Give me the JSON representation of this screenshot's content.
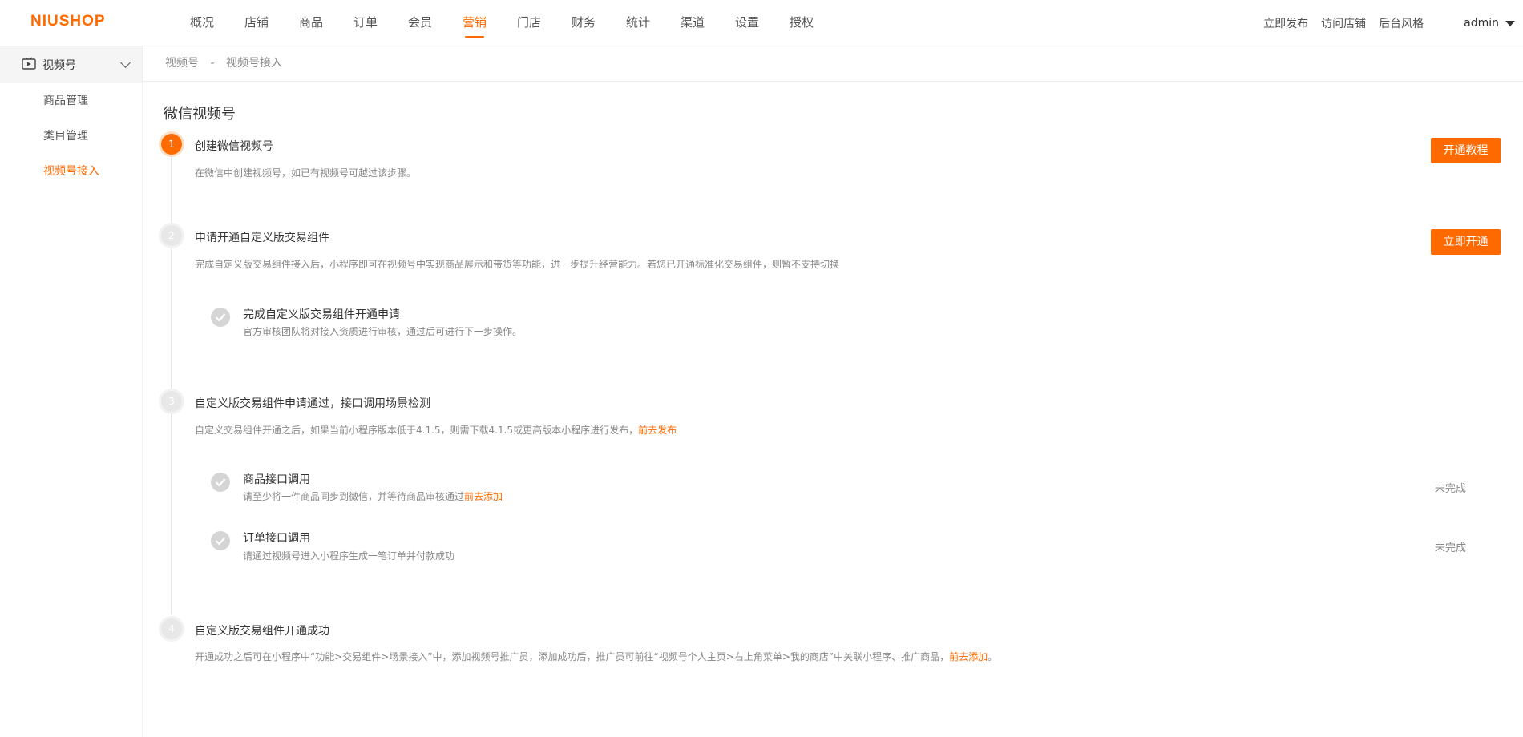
{
  "brand": {
    "logo": "NIUSHOP",
    "accent": "#ff6a00"
  },
  "nav": {
    "items": [
      "概况",
      "店铺",
      "商品",
      "订单",
      "会员",
      "营销",
      "门店",
      "财务",
      "统计",
      "渠道",
      "设置",
      "授权"
    ],
    "active": "营销"
  },
  "top_right": {
    "publish": "立即发布",
    "visit": "访问店铺",
    "theme": "后台风格",
    "user": "admin"
  },
  "sidebar": {
    "group": {
      "label": "视频号",
      "icon": "video-channel-icon"
    },
    "items": [
      "商品管理",
      "类目管理",
      "视频号接入"
    ],
    "active": "视频号接入"
  },
  "breadcrumb": {
    "parent": "视频号",
    "sep": "-",
    "current": "视频号接入"
  },
  "main": {
    "title": "微信视频号",
    "steps": [
      {
        "num": "1",
        "title": "创建微信视频号",
        "desc": "在微信中创建视频号，如已有视频号可越过该步骤。",
        "button": "开通教程"
      },
      {
        "num": "2",
        "title": "申请开通自定义版交易组件",
        "desc": "完成自定义版交易组件接入后，小程序即可在视频号中实现商品展示和带货等功能，进一步提升经营能力。若您已开通标准化交易组件，则暂不支持切换",
        "button": "立即开通",
        "sub": [
          {
            "title": "完成自定义版交易组件开通申请",
            "desc": "官方审核团队将对接入资质进行审核，通过后可进行下一步操作。"
          }
        ]
      },
      {
        "num": "3",
        "title": "自定义版交易组件申请通过，接口调用场景检测",
        "desc": "自定义交易组件开通之后，如果当前小程序版本低于4.1.5，则需下载4.1.5或更高版本小程序进行发布，",
        "desc_link": "前去发布",
        "sub": [
          {
            "title": "商品接口调用",
            "desc": "请至少将一件商品同步到微信，并等待商品审核通过",
            "link": "前去添加",
            "status": "未完成"
          },
          {
            "title": "订单接口调用",
            "desc": "请通过视频号进入小程序生成一笔订单并付款成功",
            "status": "未完成"
          }
        ]
      },
      {
        "num": "4",
        "title": "自定义版交易组件开通成功",
        "desc": "开通成功之后可在小程序中“功能>交易组件>场景接入”中，添加视频号推广员，添加成功后，推广员可前往“视频号个人主页>右上角菜单>我的商店”中关联小程序、推广商品，",
        "desc_link": "前去添加",
        "desc_end": "。"
      }
    ]
  }
}
